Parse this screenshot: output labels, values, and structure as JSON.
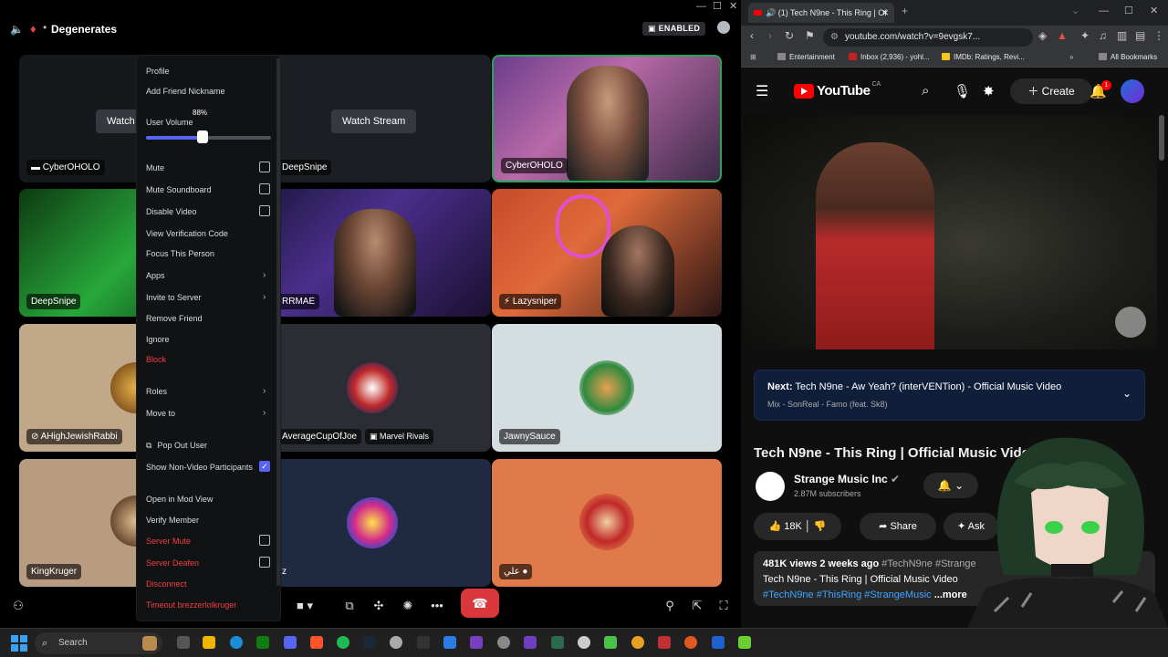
{
  "discord": {
    "channel_name": "Degenerates",
    "enabled_badge": "ENABLED",
    "tiles": [
      {
        "name": "CyberOHOLO",
        "watch": "Watch Stream"
      },
      {
        "name": "DeepSnipe",
        "watch": "Watch Stream"
      },
      {
        "name": "CyberOHOLO"
      },
      {
        "name": "DeepSnipe"
      },
      {
        "name": "RRMAE"
      },
      {
        "name": "Lazysniper"
      },
      {
        "name": "AHighJewishRabbi"
      },
      {
        "name": "AverageCupOfJoe",
        "activity": "Marvel Rivals"
      },
      {
        "name": "JawnySauce"
      },
      {
        "name": "KingKruger"
      },
      {
        "name": "z"
      },
      {
        "name": "علي"
      }
    ],
    "context_menu": {
      "profile": "Profile",
      "add_friend_nickname": "Add Friend Nickname",
      "user_volume": "User Volume",
      "volume_percent": "88%",
      "volume_fraction": 0.45,
      "mute": "Mute",
      "mute_soundboard": "Mute Soundboard",
      "disable_video": "Disable Video",
      "view_verification_code": "View Verification Code",
      "focus_this_person": "Focus This Person",
      "apps": "Apps",
      "invite_to_server": "Invite to Server",
      "remove_friend": "Remove Friend",
      "ignore": "Ignore",
      "block": "Block",
      "roles": "Roles",
      "move_to": "Move to",
      "pop_out_user": "Pop Out User",
      "show_non_video": "Show Non-Video Participants",
      "open_in_mod_view": "Open in Mod View",
      "verify_member": "Verify Member",
      "server_mute": "Server Mute",
      "server_deafen": "Server Deafen",
      "disconnect": "Disconnect",
      "timeout": "Timeout brezzerlolkruger"
    }
  },
  "browser": {
    "tab_title": "(1) Tech N9ne - This Ring | Of",
    "url": "youtube.com/watch?v=9evgsk7...",
    "bookmarks": {
      "entertainment": "Entertainment",
      "inbox": "Inbox (2,936) - yohl...",
      "imdb": "IMDb: Ratings, Revi...",
      "all_bookmarks": "All Bookmarks"
    }
  },
  "youtube": {
    "logo_text": "YouTube",
    "country": "CA",
    "create": "Create",
    "notif_count": "1",
    "next_label": "Next:",
    "next_title": "Tech N9ne - Aw Yeah? (interVENTion) - Official Music Video",
    "next_mix": "Mix - SonReal - Famo (feat. Sk8)",
    "video_title": "Tech N9ne - This Ring | Official Music Video",
    "channel_name": "Strange Music Inc",
    "subscribers": "2.87M subscribers",
    "likes": "18K",
    "share": "Share",
    "ask": "Ask",
    "views_date": "481K views  2 weeks ago",
    "desc_tags_top": "#TechN9ne #Strange",
    "desc_line2": "Tech N9ne - This Ring | Official Music Video",
    "desc_tags": "#TechN9ne #ThisRing #StrangeMusic",
    "more": "...more"
  },
  "taskbar": {
    "search": "Search"
  },
  "colors": {
    "discord_blurple": "#5865f2",
    "discord_red": "#f23f43",
    "youtube_red": "#ff0000",
    "next_card_bg": "#0f1f3a"
  }
}
